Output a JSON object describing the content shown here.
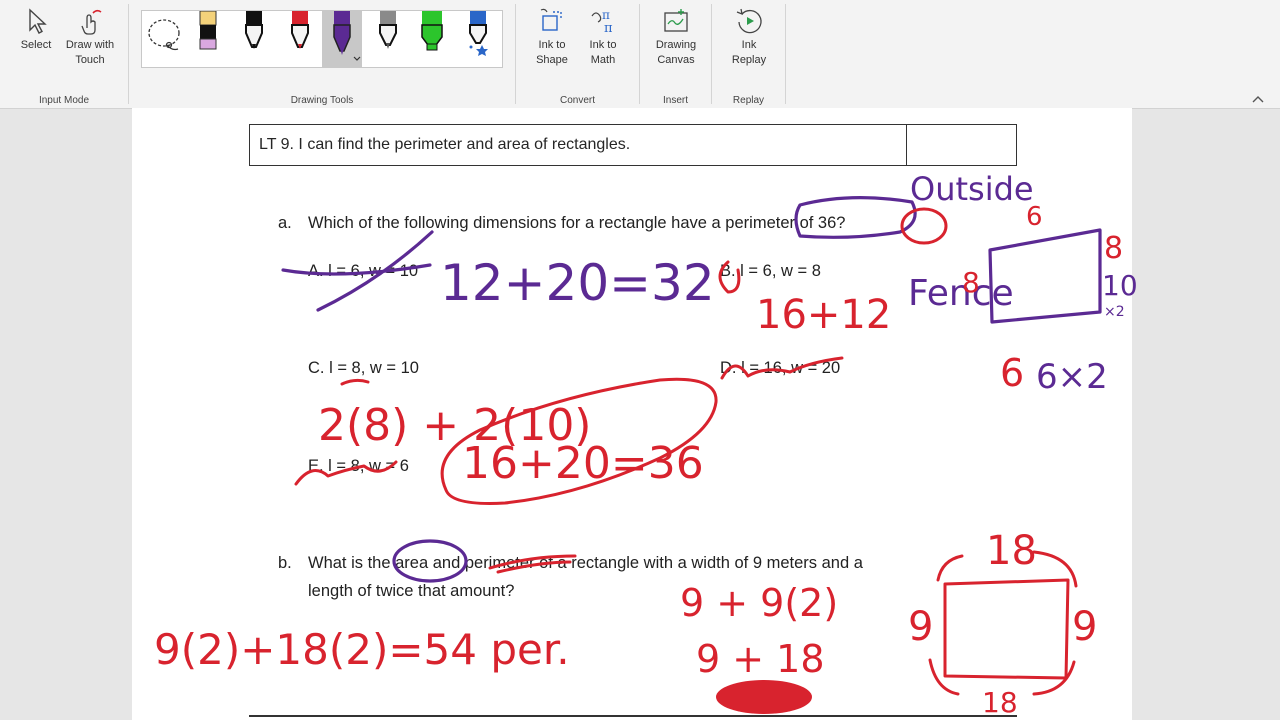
{
  "ribbon": {
    "select": "Select",
    "draw_touch_1": "Draw with",
    "draw_touch_2": "Touch",
    "input_mode": "Input Mode",
    "drawing_tools": "Drawing Tools",
    "ink_shape_1": "Ink to",
    "ink_shape_2": "Shape",
    "ink_math_1": "Ink to",
    "ink_math_2": "Math",
    "convert": "Convert",
    "canvas_1": "Drawing",
    "canvas_2": "Canvas",
    "insert": "Insert",
    "replay_1": "Ink",
    "replay_2": "Replay",
    "replay": "Replay",
    "pens": [
      {
        "name": "lasso-select-icon"
      },
      {
        "name": "highlighter-yellow-icon",
        "color": "#f4d27a"
      },
      {
        "name": "pen-black-icon",
        "color": "#111111"
      },
      {
        "name": "pen-red-icon",
        "color": "#d8232e"
      },
      {
        "name": "pen-purple-icon",
        "color": "#5b2a93"
      },
      {
        "name": "pencil-gray-icon",
        "color": "#8a8a8a"
      },
      {
        "name": "highlighter-green-icon",
        "color": "#2cc52c"
      },
      {
        "name": "pen-blue-galaxy-icon",
        "color": "#2a66c8"
      }
    ]
  },
  "document": {
    "lt_title": "LT 9. I can find the perimeter and area of rectangles.",
    "qa_label": "a.",
    "qa_text": "Which of the following dimensions for a rectangle have a perimeter of 36?",
    "optA": "A. l = 6, w = 10",
    "optB": "B. l = 6, w = 8",
    "optC": "C. l = 8, w = 10",
    "optD": "D. l = 16, w = 20",
    "optE": "E. l = 8, w = 6",
    "qb_label": "b.",
    "qb_line1": "What is the area and perimeter of a rectangle with a width of 9 meters and a",
    "qb_line2": "length of twice that amount?"
  },
  "ink": {
    "eq1": "12+20=32",
    "eq2": "16+12",
    "eq3": "2(8) + 2(10)",
    "eq4": "16+20=36",
    "outside": "Outside",
    "fence": "Fence",
    "s6a": "6",
    "s8a": "8",
    "s10": "10",
    "x2a": "×2",
    "s8b": "8",
    "s6b": "6",
    "s6x2": "6×2",
    "s18a": "18",
    "s9a": "9",
    "s9b": "9",
    "s18b": "18",
    "eq5": "9 + 9(2)",
    "eq6": "9 + 18",
    "eq7": "9(2)+18(2)=54 per."
  },
  "colors": {
    "red_ink": "#d8232e",
    "purple_ink": "#5b2a93"
  }
}
